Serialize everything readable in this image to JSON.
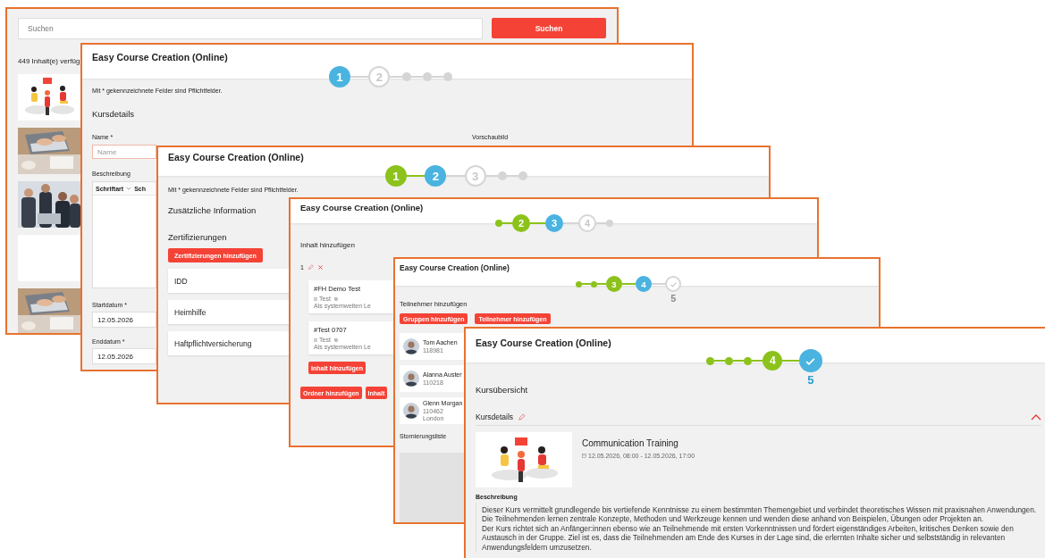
{
  "catalog": {
    "search": {
      "placeholder": "Suchen"
    },
    "search_button": "Suchen",
    "result_count": "449 Inhalt(e) verfüg",
    "thumbnails": [
      {
        "kind": "picture"
      },
      {
        "kind": "picture"
      },
      {
        "kind": "picture"
      },
      {
        "kind": "empty"
      },
      {
        "kind": "picture"
      }
    ]
  },
  "details_step": {
    "title": "Easy Course Creation (Online)",
    "steps": [
      {
        "kind": "active",
        "label": "1"
      },
      {
        "kind": "todo",
        "label": "2"
      },
      {
        "kind": "todo-dot"
      },
      {
        "kind": "todo-dot"
      },
      {
        "kind": "todo-dot"
      }
    ],
    "required_note": "Mit * gekennzeichnete Felder sind Pflichtfelder.",
    "section": "Kursdetails",
    "name_field": {
      "label": "Name *",
      "placeholder": "Name"
    },
    "preview_label": "Vorschaubild",
    "description": {
      "label": "Beschreibung",
      "toolbar": [
        {
          "label": "Schriftart",
          "dropdown": true
        },
        {
          "label": "Sch",
          "dropdown": false
        }
      ]
    },
    "start_date": {
      "label": "Startdatum *",
      "value": "12.05.2026"
    },
    "end_date": {
      "label": "Enddatum *",
      "value": "12.05.2026"
    }
  },
  "info_step": {
    "title": "Easy Course Creation (Online)",
    "steps": [
      {
        "kind": "done",
        "label": "1"
      },
      {
        "kind": "active",
        "label": "2"
      },
      {
        "kind": "todo",
        "label": "3"
      },
      {
        "kind": "todo-dot"
      },
      {
        "kind": "todo-dot"
      }
    ],
    "required_note": "Mit * gekennzeichnete Felder sind Pflichtfelder.",
    "section": "Zusätzliche Information",
    "subsection": "Zertifizierungen",
    "add_button": "Zertifizierungen hinzufügen",
    "certificates": [
      "IDD",
      "Heimhilfe",
      "Haftpflichtversicherung"
    ]
  },
  "content_step": {
    "title": "Easy Course Creation (Online)",
    "steps": [
      {
        "kind": "done-dot"
      },
      {
        "kind": "done",
        "label": "2"
      },
      {
        "kind": "active",
        "label": "3"
      },
      {
        "kind": "todo",
        "label": "4"
      },
      {
        "kind": "todo-dot"
      }
    ],
    "section": "Inhalt hinzufügen",
    "group_index": "1",
    "contents": [
      {
        "title": "#FH Demo Test",
        "type": "Test",
        "scope": "Als systemweiten Le"
      },
      {
        "title": "#Test 0707",
        "type": "Test",
        "scope": "Als systemweiten Le"
      }
    ],
    "add_content_button": "Inhalt hinzufügen",
    "buttons": [
      "Ordner hinzufügen",
      "Inhalt"
    ]
  },
  "participants_step": {
    "title": "Easy Course Creation (Online)",
    "steps": [
      {
        "kind": "done-dot"
      },
      {
        "kind": "done-dot"
      },
      {
        "kind": "done",
        "label": "3"
      },
      {
        "kind": "active",
        "label": "4"
      },
      {
        "kind": "check-todo",
        "caption": "5"
      }
    ],
    "section": "Teilnehmer hinzufügen",
    "buttons": [
      "Gruppen hinzufügen",
      "Teilnehmer hinzufügen"
    ],
    "participants": [
      {
        "name": "Tom Aachen",
        "id": "118981"
      },
      {
        "name": "Alanna Auster",
        "id": "110218"
      },
      {
        "name": "Glenn Morgan",
        "id": "110462",
        "location": "London"
      }
    ],
    "cancellation_label": "Stornierungsliste"
  },
  "overview_step": {
    "title": "Easy Course Creation (Online)",
    "steps": [
      {
        "kind": "done-dot"
      },
      {
        "kind": "done-dot"
      },
      {
        "kind": "done-dot"
      },
      {
        "kind": "done",
        "label": "4"
      },
      {
        "kind": "check-active",
        "caption": "5"
      }
    ],
    "section": "Kursübersicht",
    "details_label": "Kursdetails",
    "details_expanded": true,
    "course": {
      "title": "Communication Training",
      "schedule": "12.05.2026, 08:00 - 12.05.2026, 17:00"
    },
    "description_label": "Beschreibung",
    "description": [
      "Dieser Kurs vermittelt grundlegende bis vertiefende Kenntnisse zu einem bestimmten Themengebiet und verbindet theoretisches Wissen mit praxisnahen Anwendungen. Die Teilnehmenden lernen zentrale Konzepte, Methoden und Werkzeuge kennen und wenden diese anhand von Beispielen, Übungen oder Projekten an.",
      "Der Kurs richtet sich an Anfänger:innen ebenso wie an Teilnehmende mit ersten Vorkenntnissen und fördert eigenständiges Arbeiten, kritisches Denken sowie den Austausch in der Gruppe. Ziel ist es, dass die Teilnehmenden am Ende des Kurses in der Lage sind, die erlernten Inhalte sicher und selbstständig in relevanten Anwendungsfeldern umzusetzen."
    ]
  }
}
